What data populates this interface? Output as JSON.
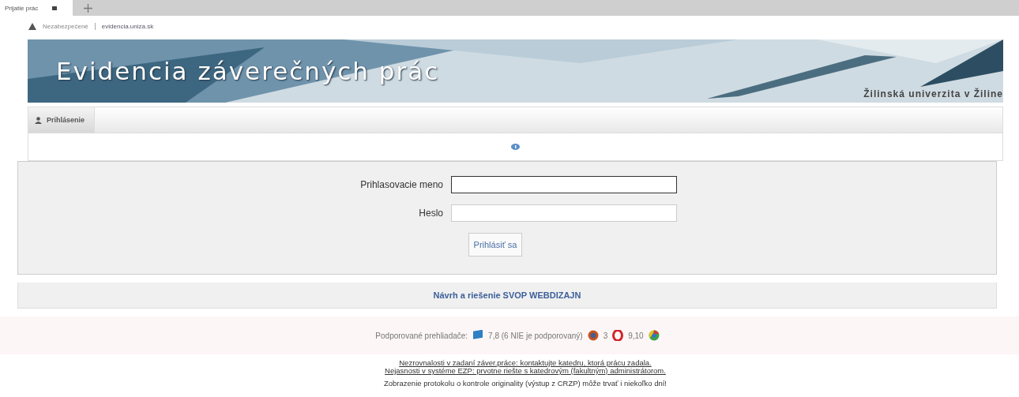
{
  "browser": {
    "tab_title": "Prijatie prác",
    "security": "Nezabezpečené",
    "url": "evidencia.uniza.sk"
  },
  "banner": {
    "title": "Evidencia záverečných prác",
    "university": "Žilinská univerzita v Žiline"
  },
  "menu": [
    {
      "label": "Prihlásenie",
      "selected": true
    }
  ],
  "login": {
    "fields": [
      {
        "label": "Prihlasovacie meno",
        "focused": true
      },
      {
        "label": "Heslo",
        "focused": false
      }
    ],
    "button": "Prihlásiť sa"
  },
  "credit": "Návrh a riešenie SVOP WEBDIZAJN",
  "browsers": {
    "label": "Podporované prehliadače:",
    "items": [
      {
        "kind": "ie",
        "version": "7,8 (6 NIE je podporovaný)"
      },
      {
        "kind": "firefox",
        "version": "3"
      },
      {
        "kind": "opera",
        "version": "9,10"
      },
      {
        "kind": "chrome"
      }
    ]
  },
  "notes": [
    "Nezrovnalosti v zadaní záver.práce: kontaktujte katedru, ktorá prácu zadala.",
    "Nejasnosti v systéme EZP: prvotne riešte s katedrovým (fakultným) administrátorom.",
    "Zobrazenie protokolu o kontrole originality (výstup z CRZP) môže trvať i niekoľko dní!"
  ]
}
